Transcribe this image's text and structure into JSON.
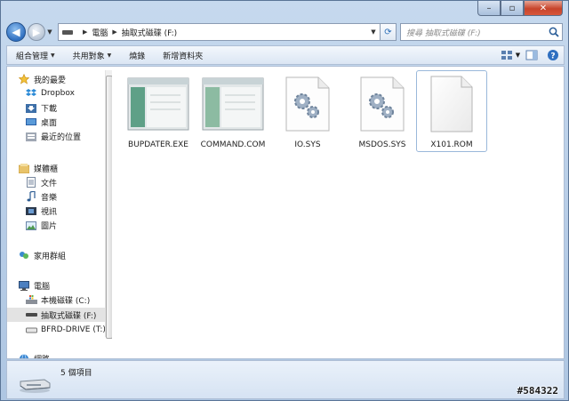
{
  "window": {
    "caption": {
      "minimize": "–",
      "maximize": "▫",
      "close": "✕"
    }
  },
  "nav": {
    "back_icon": "back-arrow-icon",
    "forward_icon": "forward-arrow-icon",
    "breadcrumb": [
      "電腦",
      "抽取式磁碟 (F:)"
    ],
    "search_placeholder": "搜尋 抽取式磁碟 (F:)"
  },
  "toolbar": {
    "organize": "組合管理",
    "share": "共用對象",
    "burn": "燒錄",
    "new_folder": "新增資料夾"
  },
  "sidebar": {
    "favorites": "我的最愛",
    "dropbox": "Dropbox",
    "downloads": "下載",
    "desktop": "桌面",
    "recent": "最近的位置",
    "libraries": "媒體櫃",
    "documents": "文件",
    "music": "音樂",
    "videos": "視訊",
    "pictures": "圖片",
    "homegroup": "家用群組",
    "computer": "電腦",
    "local_disk": "本機磁碟 (C:)",
    "removable": "抽取式磁碟 (F:)",
    "bfrd": "BFRD-DRIVE (T:)",
    "network": "網路"
  },
  "files": [
    {
      "name": "BUPDATER.EXE",
      "icon": "exe-window-icon"
    },
    {
      "name": "COMMAND.COM",
      "icon": "com-window-icon"
    },
    {
      "name": "IO.SYS",
      "icon": "system-file-gears-icon"
    },
    {
      "name": "MSDOS.SYS",
      "icon": "system-file-gears-icon"
    },
    {
      "name": "X101.ROM",
      "icon": "blank-file-icon"
    }
  ],
  "status": {
    "item_count": "5 個項目"
  },
  "watermark": "#584322",
  "colors": {
    "accent": "#2f6fc0",
    "close": "#c7442b",
    "selection": "#e3e3e3"
  }
}
